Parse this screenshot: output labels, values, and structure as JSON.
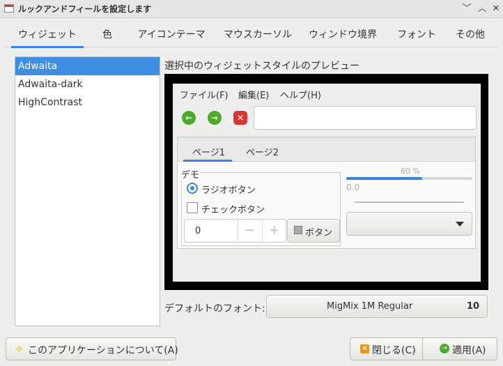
{
  "window": {
    "title": "ルックアンドフィールを設定します"
  },
  "tabs": [
    "ウィジェット",
    "色",
    "アイコンテーマ",
    "マウスカーソル",
    "ウィンドウ境界",
    "フォント",
    "その他"
  ],
  "themes": {
    "items": [
      "Adwaita",
      "Adwaita-dark",
      "HighContrast"
    ],
    "selected": "Adwaita"
  },
  "preview": {
    "title": "選択中のウィジェットスタイルのプレビュー",
    "menu": [
      "ファイル(F)",
      "編集(E)",
      "ヘルプ(H)"
    ],
    "toolbar_icons": [
      "go-back-icon",
      "go-forward-icon",
      "stop-icon"
    ],
    "notebook_tabs": [
      "ページ1",
      "ページ2"
    ],
    "demo_label": "デモ",
    "radio_label": "ラジオボタン",
    "check_label": "チェックボタン",
    "spin_value": "0",
    "spin_minus": "−",
    "spin_plus": "+",
    "button_label": "ボタン",
    "progress_text": "60 %",
    "progress_value": 0.6,
    "scale_value": "0.0"
  },
  "font": {
    "label": "デフォルトのフォント:",
    "name": "MigMix 1M Regular",
    "size": "10"
  },
  "buttons": {
    "about": "このアプリケーションについて(A)",
    "close": "閉じる(C)",
    "apply": "適用(A)"
  },
  "colors": {
    "accent": "#3584e4",
    "selection": "#3d8ee0",
    "stop_red": "#d93434",
    "nav_green": "#4caa2a"
  }
}
